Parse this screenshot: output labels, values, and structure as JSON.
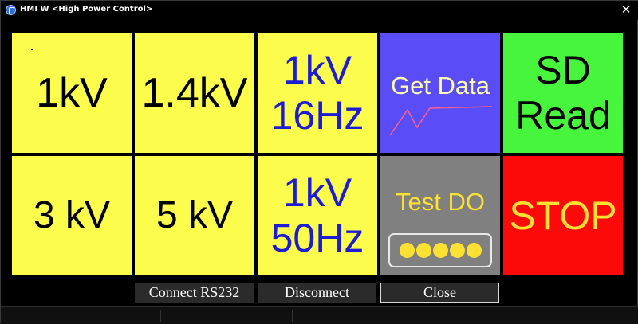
{
  "window": {
    "title": "HMI W <High Power Control>",
    "close_glyph": "✕"
  },
  "tiles": {
    "kv1": "1kV",
    "kv1_4": "1.4kV",
    "kv1_16hz_line1": "1kV",
    "kv1_16hz_line2": "16Hz",
    "get_data": "Get Data",
    "sd_read_line1": "SD",
    "sd_read_line2": "Read",
    "kv3": "3 kV",
    "kv5": "5 kV",
    "kv1_50hz_line1": "1kV",
    "kv1_50hz_line2": "50Hz",
    "test_do": "Test DO",
    "stop": "STOP"
  },
  "buttons": {
    "connect": "Connect RS232",
    "disconnect": "Disconnect",
    "close": "Close"
  },
  "colors": {
    "yellow_tile": "#fcfc4c",
    "blue_text": "#1c1cd6",
    "get_data_bg": "#5a4df7",
    "sd_read_bg": "#46f53c",
    "test_do_bg": "#808080",
    "stop_bg": "#fc0a0a",
    "accent_yellow": "#fce032"
  },
  "icons": {
    "app": "app-icon",
    "graph": "line-graph-icon",
    "leds": "led-indicator-icon"
  }
}
